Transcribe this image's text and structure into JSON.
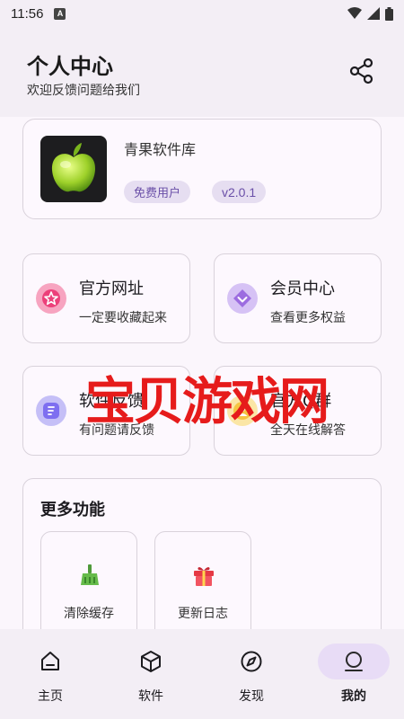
{
  "status_bar": {
    "time": "11:56",
    "indicator": "A"
  },
  "header": {
    "title": "个人中心",
    "subtitle": "欢迎反馈问题给我们",
    "share_icon": "share-icon"
  },
  "app_card": {
    "name": "青果软件库",
    "tags": [
      "免费用户",
      "v2.0.1"
    ],
    "logo": "green-apple-logo"
  },
  "features": [
    {
      "title": "官方网址",
      "desc": "一定要收藏起来",
      "icon": "star-icon",
      "color": "#f06292"
    },
    {
      "title": "会员中心",
      "desc": "查看更多权益",
      "icon": "vip-diamond-icon",
      "color": "#9c6ce0"
    },
    {
      "title": "软件反馈",
      "desc": "有问题请反馈",
      "icon": "feedback-icon",
      "color": "#8a7cf0"
    },
    {
      "title": "官方Q群",
      "desc": "全天在线解答",
      "icon": "group-icon",
      "color": "#f5c542"
    }
  ],
  "more": {
    "title": "更多功能",
    "tools": [
      {
        "label": "清除缓存",
        "icon": "broom-icon"
      },
      {
        "label": "更新日志",
        "icon": "gift-icon"
      }
    ]
  },
  "watermark": "宝贝游戏网",
  "nav": {
    "items": [
      {
        "label": "主页",
        "icon": "home-icon"
      },
      {
        "label": "软件",
        "icon": "box-icon"
      },
      {
        "label": "发现",
        "icon": "compass-icon"
      },
      {
        "label": "我的",
        "icon": "profile-icon"
      }
    ],
    "active_index": 3
  }
}
